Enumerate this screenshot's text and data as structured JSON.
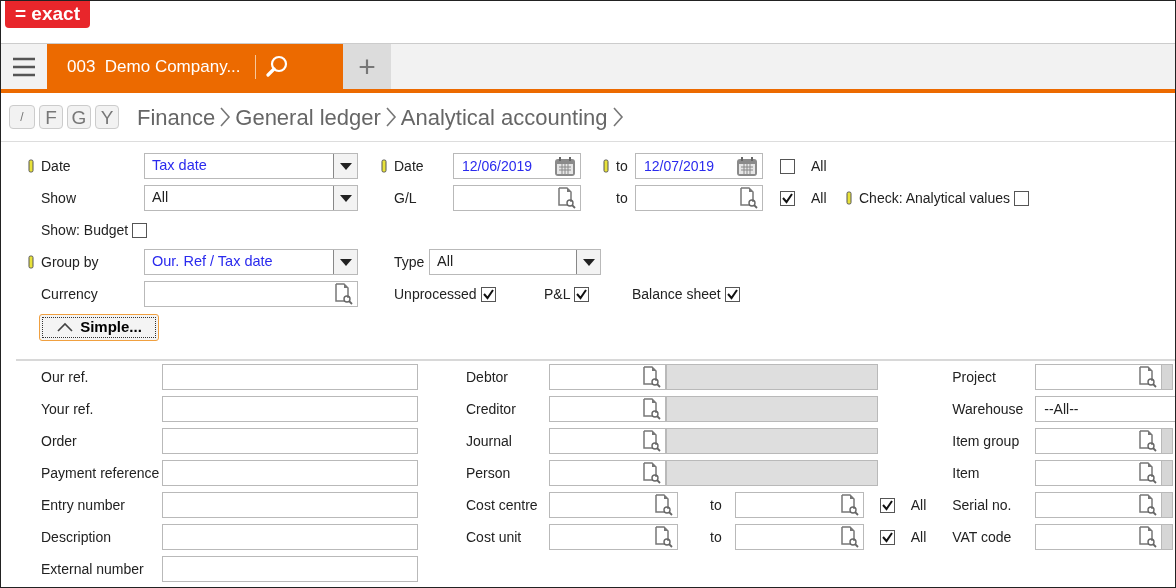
{
  "logo": "= exact",
  "tabs": [
    {
      "label": "003  Demo Company...",
      "selected": true
    }
  ],
  "new_tab": "+",
  "shortcuts": [
    "/",
    "F",
    "G",
    "Y"
  ],
  "breadcrumb": [
    "Finance",
    "General ledger",
    "Analytical accounting"
  ],
  "filters": [
    {
      "items": [
        {
          "kind": "label",
          "text": "Date",
          "flagged": true
        },
        {
          "kind": "select",
          "value": "Tax date",
          "modified": true
        },
        {
          "kind": "label",
          "text": "Date",
          "flagged": true
        },
        {
          "kind": "date",
          "value": "12/06/2019",
          "modified": true
        },
        {
          "kind": "label",
          "text": "to",
          "flagged": true
        },
        {
          "kind": "date",
          "value": "12/07/2019",
          "modified": true
        },
        {
          "kind": "checkbox",
          "text": "All",
          "checked": false
        }
      ]
    },
    {
      "items": [
        {
          "kind": "label",
          "text": "Show",
          "flagged": false
        },
        {
          "kind": "select",
          "value": "All",
          "modified": false
        },
        {
          "kind": "label",
          "text": "G/L",
          "flagged": false
        },
        {
          "kind": "lookup"
        },
        {
          "kind": "label",
          "text": "to",
          "flagged": false
        },
        {
          "kind": "lookup"
        },
        {
          "kind": "checkbox",
          "text": "All",
          "checked": true
        },
        {
          "kind": "labeled-check",
          "text": "Check: Analytical values",
          "flagged": true,
          "checked": false
        }
      ]
    },
    {
      "items": [
        {
          "kind": "labeled-check",
          "text": "Show: Budget",
          "flagged": false,
          "checked": false
        }
      ]
    },
    {
      "items": [
        {
          "kind": "label",
          "text": "Group by",
          "flagged": true
        },
        {
          "kind": "select",
          "value": "Our. Ref / Tax date",
          "modified": true
        },
        {
          "kind": "label",
          "text": "Type",
          "flagged": false
        },
        {
          "kind": "select",
          "value": "All",
          "modified": false
        }
      ]
    },
    {
      "items": [
        {
          "kind": "label",
          "text": "Currency",
          "flagged": false
        },
        {
          "kind": "lookup"
        },
        {
          "kind": "labeled-check",
          "text": "Unprocessed",
          "flagged": false,
          "checked": true
        },
        {
          "kind": "labeled-check",
          "text": "P&L",
          "flagged": false,
          "checked": true
        },
        {
          "kind": "labeled-check",
          "text": "Balance sheet",
          "flagged": false,
          "checked": true
        }
      ]
    }
  ],
  "toggle_button": "Simple...",
  "criteria": [
    {
      "rows": [
        {
          "label": "Our ref.",
          "kind": "text"
        },
        {
          "label": "Your ref.",
          "kind": "text"
        },
        {
          "label": "Order",
          "kind": "text"
        },
        {
          "label": "Payment reference",
          "kind": "text"
        },
        {
          "label": "Entry number",
          "kind": "text"
        },
        {
          "label": "Description",
          "kind": "text"
        },
        {
          "label": "External number",
          "kind": "text"
        }
      ]
    },
    {
      "rows": [
        {
          "label": "Debtor",
          "kind": "lookup-name"
        },
        {
          "label": "Creditor",
          "kind": "lookup-name"
        },
        {
          "label": "Journal",
          "kind": "lookup-name"
        },
        {
          "label": "Person",
          "kind": "lookup-name"
        },
        {
          "label": "Cost centre",
          "kind": "range",
          "to": "to",
          "all": "All",
          "checked": true
        },
        {
          "label": "Cost unit",
          "kind": "range",
          "to": "to",
          "all": "All",
          "checked": true
        }
      ]
    },
    {
      "rows": [
        {
          "label": "Project",
          "kind": "lookup"
        },
        {
          "label": "Warehouse",
          "kind": "text",
          "value": "--All--"
        },
        {
          "label": "Item group",
          "kind": "lookup"
        },
        {
          "label": "Item",
          "kind": "lookup"
        },
        {
          "label": "Serial no.",
          "kind": "lookup"
        },
        {
          "label": "VAT code",
          "kind": "lookup"
        }
      ]
    }
  ]
}
